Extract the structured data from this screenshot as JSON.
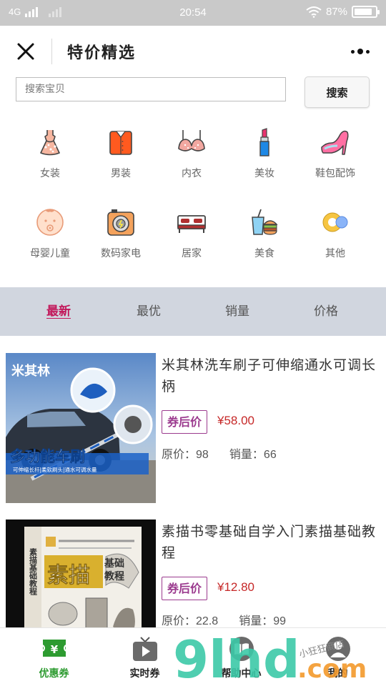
{
  "status_bar": {
    "network": "4G",
    "time": "20:54",
    "battery_text": "87%",
    "battery_level": 0.87
  },
  "header": {
    "title": "特价精选",
    "close_icon": "close-icon",
    "more_icon": "more-dots-icon"
  },
  "search": {
    "placeholder": "搜索宝贝",
    "value": "",
    "button_label": "搜索"
  },
  "categories": [
    {
      "label": "女装",
      "icon": "dress-icon"
    },
    {
      "label": "男装",
      "icon": "shirt-icon"
    },
    {
      "label": "内衣",
      "icon": "bra-icon"
    },
    {
      "label": "美妆",
      "icon": "lipstick-icon"
    },
    {
      "label": "鞋包配饰",
      "icon": "high-heel-icon"
    },
    {
      "label": "母婴儿童",
      "icon": "baby-icon"
    },
    {
      "label": "数码家电",
      "icon": "camera-icon"
    },
    {
      "label": "居家",
      "icon": "bed-icon"
    },
    {
      "label": "美食",
      "icon": "food-icon"
    },
    {
      "label": "其他",
      "icon": "other-circles-icon"
    }
  ],
  "sort_tabs": [
    {
      "label": "最新",
      "active": true
    },
    {
      "label": "最优",
      "active": false
    },
    {
      "label": "销量",
      "active": false
    },
    {
      "label": "价格",
      "active": false
    }
  ],
  "products": [
    {
      "title": "米其林洗车刷子可伸缩通水可调长柄",
      "coupon_label": "券后价",
      "coupon_price": "¥58.00",
      "original_label": "原价：",
      "original_price": "98",
      "sales_label": "销量：",
      "sales": "66",
      "image_texts": {
        "brand": "米其林",
        "headline": "多功能车刷",
        "caption": "可伸缩长杆|柔软刷头|通水可调水量"
      }
    },
    {
      "title": "素描书零基础自学入门素描基础教程",
      "coupon_label": "券后价",
      "coupon_price": "¥12.80",
      "original_label": "原价：",
      "original_price": "22.8",
      "sales_label": "销量：",
      "sales": "99",
      "image_texts": {
        "big": "素描",
        "sub1": "基础",
        "sub2": "教程",
        "spine": "素描基础教程"
      }
    }
  ],
  "tabbar": [
    {
      "label": "优惠券",
      "icon": "coupon-ticket-icon",
      "active": true
    },
    {
      "label": "实时券",
      "icon": "tv-play-icon",
      "active": false
    },
    {
      "label": "帮助中心",
      "icon": "book-icon",
      "active": false
    },
    {
      "label": "我的",
      "icon": "user-icon",
      "active": false
    }
  ],
  "watermark": {
    "logo": "9lhd.com",
    "text": "小狂狂商店"
  },
  "colors": {
    "accent_active": "#c2185b",
    "coupon_border": "#9b3a8e",
    "price_red": "#c62828",
    "tab_active_green": "#2d9b30",
    "sort_bar_bg": "#d1d6df",
    "status_bar_bg": "#c9c9c9"
  }
}
